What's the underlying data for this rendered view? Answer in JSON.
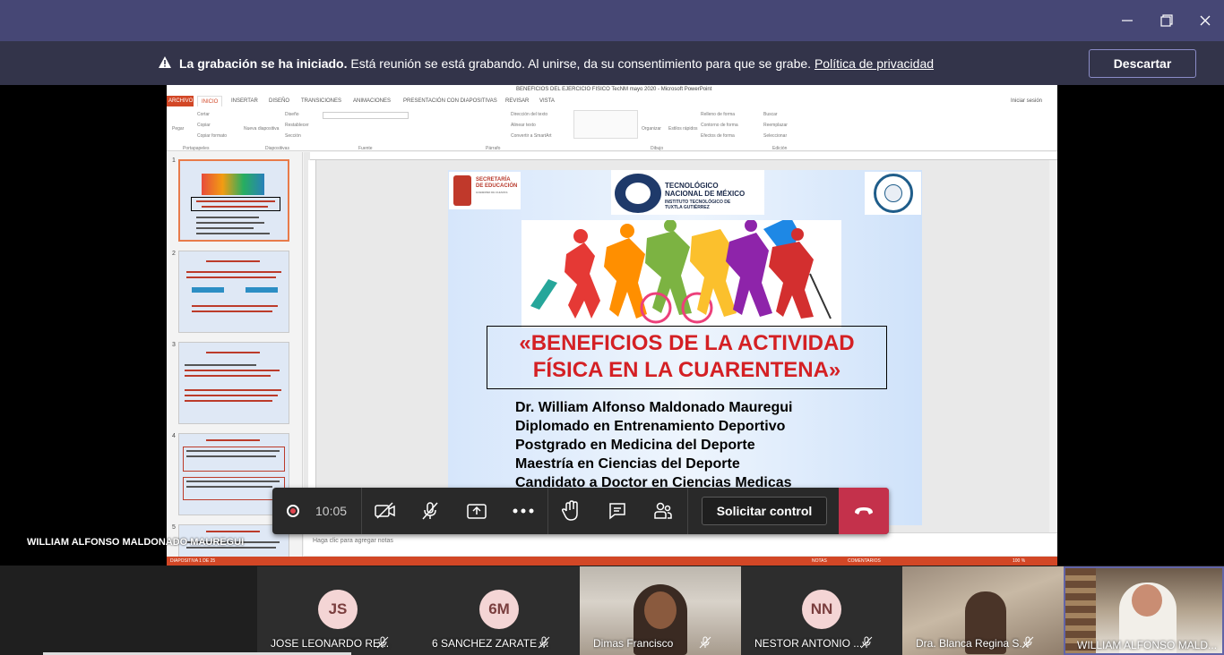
{
  "window": {
    "minimize_icon": "minimize-icon",
    "maximize_icon": "maximize-icon",
    "close_icon": "close-icon"
  },
  "banner": {
    "bold": "La grabación se ha iniciado.",
    "text": " Está reunión se está grabando. Al unirse, da su consentimiento para que se grabe. ",
    "link": "Política de privacidad",
    "dismiss": "Descartar"
  },
  "ppt": {
    "window_title": "BENEFICIOS DEL EJERCICIO FISICO TecNM mayo 2020 - Microsoft PowerPoint",
    "tabs": [
      "ARCHIVO",
      "INICIO",
      "INSERTAR",
      "DISEÑO",
      "TRANSICIONES",
      "ANIMACIONES",
      "PRESENTACIÓN CON DIAPOSITIVAS",
      "REVISAR",
      "VISTA"
    ],
    "sign_in": "Iniciar sesión",
    "groups": [
      "Portapapeles",
      "Diapositivas",
      "Fuente",
      "Párrafo",
      "Dibujo",
      "Edición"
    ],
    "ribbon_items": [
      "Cortar",
      "Copiar",
      "Copiar formato",
      "Pegar",
      "Nueva diapositiva",
      "Diseño",
      "Restablecer",
      "Sección",
      "Dirección del texto",
      "Alinear texto",
      "Convertir a SmartArt",
      "Organizar",
      "Estilos rápidos",
      "Relleno de forma",
      "Contorno de forma",
      "Efectos de forma",
      "Buscar",
      "Reemplazar",
      "Seleccionar"
    ],
    "notes_placeholder": "Haga clic para agregar notas",
    "status_left": "DIAPOSITIVA 1 DE 25",
    "status_notes": "NOTAS",
    "status_comments": "COMENTARIOS",
    "zoom": "100 %",
    "thumbnail_numbers": [
      "1",
      "2",
      "3",
      "4",
      "5"
    ]
  },
  "slide": {
    "sec_logo_text": [
      "SECRETARÍA",
      "DE EDUCACIÓN",
      "GOBIERNO DE CHIAPAS"
    ],
    "tnm_line1": "TECNOLÓGICO",
    "tnm_line2": "NACIONAL DE MÉXICO",
    "tnm_line3": "INSTITUTO TECNOLÓGICO DE",
    "tnm_line4": "TUXTLA GUTIÉRREZ",
    "title_line1": "«BENEFICIOS DE LA ACTIVIDAD",
    "title_line2": "FÍSICA EN LA CUARENTENA»",
    "credentials": [
      "Dr. William Alfonso Maldonado Mauregui",
      "Diplomado en Entrenamiento Deportivo",
      "Postgrado en Medicina del Deporte",
      "Maestría en Ciencias del Deporte",
      "Candidato a Doctor en Ciencias Medicas"
    ]
  },
  "controls": {
    "timer": "10:05",
    "request_control": "Solicitar control"
  },
  "presenter": "WILLIAM ALFONSO MALDONADO MAUREGUI",
  "participants": [
    {
      "initials": "JS",
      "name": "JOSE LEONARDO RE..."
    },
    {
      "initials": "6M",
      "name": "6 SANCHEZ ZARATE ..."
    },
    {
      "initials": "",
      "name": "Dimas Francisco"
    },
    {
      "initials": "NN",
      "name": "NESTOR ANTONIO ..."
    },
    {
      "initials": "",
      "name": "Dra. Blanca Regina S..."
    },
    {
      "initials": "",
      "name": "WILLIAM ALFONSO MALD..."
    }
  ],
  "colors": {
    "titlebar": "#464775",
    "banner": "#33344a",
    "hangup": "#c4314b",
    "ppt_accent": "#d24726",
    "slide_title": "#d42024"
  }
}
